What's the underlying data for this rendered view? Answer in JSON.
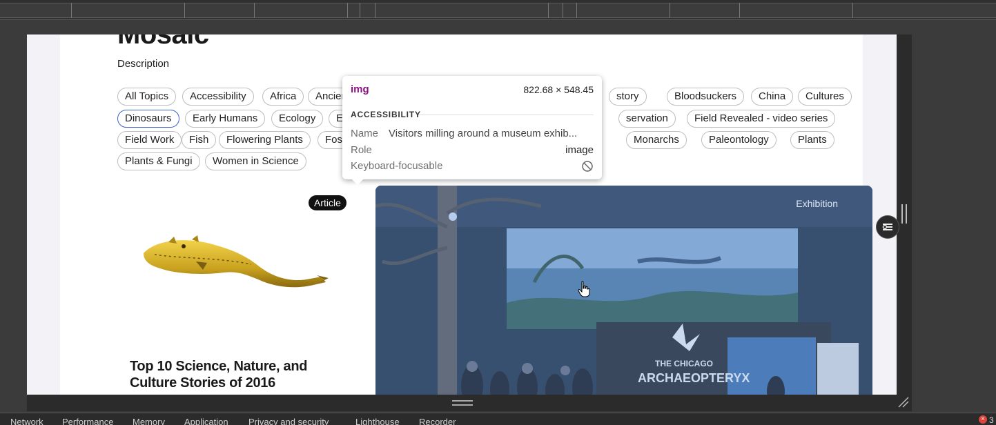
{
  "page": {
    "title": "Mosaic",
    "description": "Description"
  },
  "topics": [
    "All Topics",
    "Accessibility",
    "Africa",
    "Ancient Ame",
    "story",
    "Bloodsuckers",
    "China",
    "Cultures",
    "Dinosaurs",
    "Early Humans",
    "Ecology",
    "Egypt",
    "servation",
    "Field Revealed - video series",
    "Field Work",
    "Fish",
    "Flowering Plants",
    "Fossils",
    "Monarchs",
    "Paleontology",
    "Plants",
    "Plants & Fungi",
    "Women in Science"
  ],
  "active_topic": "Dinosaurs",
  "cards": {
    "left": {
      "badge": "Article",
      "title": "Top 10 Science, Nature, and Culture Stories of 2016"
    },
    "right": {
      "badge": "Exhibition",
      "sign_text": "THE CHICAGO ARCHAEOPTERYX"
    }
  },
  "tooltip": {
    "tag": "img",
    "size": "822.68 × 548.45",
    "section": "ACCESSIBILITY",
    "name_label": "Name",
    "name_value": "Visitors milling around a museum exhib...",
    "role_label": "Role",
    "role_value": "image",
    "focus_label": "Keyboard-focusable",
    "focus_icon": "blocked-icon"
  },
  "devtools_tabs": [
    "Network",
    "Performance",
    "Memory",
    "Application",
    "Privacy and security",
    "Lighthouse",
    "Recorder"
  ],
  "error_count": "3",
  "colors": {
    "active_chip_border": "#3b63c9",
    "tag_purple": "#881280",
    "error_red": "#e0433a"
  }
}
